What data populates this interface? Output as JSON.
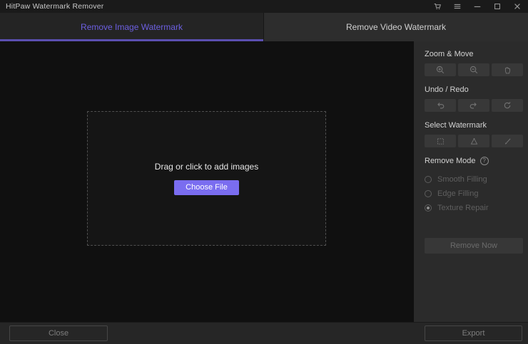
{
  "titlebar": {
    "title": "HitPaw Watermark Remover"
  },
  "tabs": {
    "image": {
      "label": "Remove Image Watermark",
      "active": true
    },
    "video": {
      "label": "Remove Video Watermark",
      "active": false
    }
  },
  "dropzone": {
    "hint": "Drag or click to add images",
    "choose_file_label": "Choose File"
  },
  "panel": {
    "zoom_move_title": "Zoom & Move",
    "undo_redo_title": "Undo / Redo",
    "select_watermark_title": "Select Watermark",
    "remove_mode_title": "Remove Mode",
    "info_glyph": "?",
    "modes": [
      {
        "label": "Smooth Filling",
        "selected": false
      },
      {
        "label": "Edge Filling",
        "selected": false
      },
      {
        "label": "Texture Repair",
        "selected": true
      }
    ],
    "remove_now_label": "Remove Now"
  },
  "footer": {
    "close_label": "Close",
    "export_label": "Export"
  },
  "colors": {
    "accent_purple": "#7a6df0",
    "active_tab_text": "#6c5fe0",
    "tab_underline": "#5b4fb0",
    "panel_bg": "#2b2b2b",
    "canvas_bg": "#101010"
  }
}
